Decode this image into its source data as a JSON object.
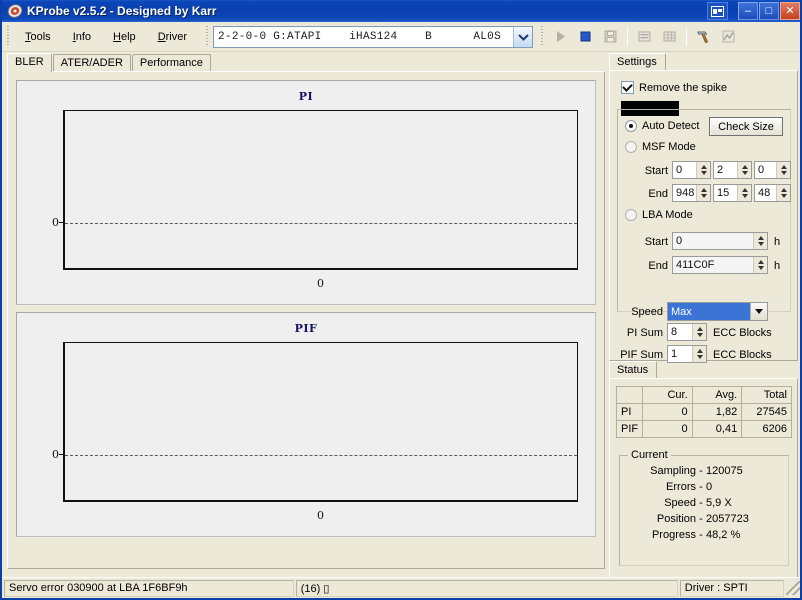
{
  "window": {
    "title": "KProbe v2.5.2 - Designed by Karr",
    "app_icon": "disc-icon",
    "restore_label": "❑",
    "minimize_label": "–",
    "maximize_label": "□",
    "close_label": "✕"
  },
  "menu": {
    "items": [
      {
        "pre": "",
        "accel": "T",
        "post": "ools"
      },
      {
        "pre": "",
        "accel": "I",
        "post": "nfo"
      },
      {
        "pre": "",
        "accel": "H",
        "post": "elp"
      },
      {
        "pre": "",
        "accel": "D",
        "post": "river"
      }
    ]
  },
  "drive": {
    "value": "2-2-0-0 G:ATAPI    iHAS124    B      AL0S",
    "dropdown_icon": "chevron-down-icon"
  },
  "toolbar": {
    "buttons": [
      {
        "name": "start-scan-button",
        "icon": "play-icon",
        "enabled": false
      },
      {
        "name": "stop-scan-button",
        "icon": "stop-square-icon",
        "enabled": true
      },
      {
        "name": "save-button",
        "icon": "save-disk-icon",
        "enabled": false
      },
      {
        "name": "list-view-button",
        "icon": "list-icon",
        "enabled": false
      },
      {
        "name": "grid-view-button",
        "icon": "grid-icon",
        "enabled": false
      },
      {
        "name": "tools-button",
        "icon": "hammer-icon",
        "enabled": true
      },
      {
        "name": "graph-button",
        "icon": "chart-icon",
        "enabled": false
      }
    ]
  },
  "tabs": [
    {
      "label": "BLER",
      "selected": true
    },
    {
      "label": "ATER/ADER",
      "selected": false
    },
    {
      "label": "Performance",
      "selected": false
    }
  ],
  "chart_data": [
    {
      "type": "line",
      "title": "PI",
      "xlabel": "",
      "ylabel": "",
      "x": [],
      "values": [],
      "yticks": [
        "0"
      ],
      "xticks": [
        "0"
      ],
      "xlim": [
        0,
        0
      ],
      "ylim": [
        0,
        0
      ],
      "grid": true,
      "legend": "none",
      "note": "empty plot; single dashed gridline at y=0"
    },
    {
      "type": "line",
      "title": "PIF",
      "xlabel": "",
      "ylabel": "",
      "x": [],
      "values": [],
      "yticks": [
        "0"
      ],
      "xticks": [
        "0"
      ],
      "xlim": [
        0,
        0
      ],
      "ylim": [
        0,
        0
      ],
      "grid": true,
      "legend": "none",
      "note": "empty plot; single dashed gridline at y=0"
    }
  ],
  "settings": {
    "header": "Settings",
    "remove_spike": {
      "label": "Remove the spike",
      "checked": true
    },
    "auto_detect": {
      "label": "Auto Detect",
      "selected": true
    },
    "check_size": {
      "label": "Check Size"
    },
    "msf_mode": {
      "label": "MSF Mode",
      "selected": false
    },
    "msf_start_label": "Start",
    "msf_start": [
      "0",
      "2",
      "0"
    ],
    "msf_end_label": "End",
    "msf_end": [
      "948",
      "15",
      "48"
    ],
    "lba_mode": {
      "label": "LBA Mode",
      "selected": false
    },
    "lba_start_label": "Start",
    "lba_start": "0",
    "lba_start_unit": "h",
    "lba_end_label": "End",
    "lba_end": "411C0F",
    "lba_end_unit": "h",
    "speed_label": "Speed",
    "speed_value": "Max",
    "pi_sum_label": "PI Sum",
    "pi_sum_value": "8",
    "pi_sum_unit": "ECC Blocks",
    "pif_sum_label": "PIF Sum",
    "pif_sum_value": "1",
    "pif_sum_unit": "ECC Blocks"
  },
  "status": {
    "header": "Status",
    "table": {
      "columns": [
        "",
        "Cur.",
        "Avg.",
        "Total"
      ],
      "rows": [
        {
          "name": "PI",
          "cur": "0",
          "avg": "1,82",
          "total": "27545"
        },
        {
          "name": "PIF",
          "cur": "0",
          "avg": "0,41",
          "total": "6206"
        }
      ]
    },
    "current": {
      "title": "Current",
      "rows": [
        {
          "key": "Sampling",
          "dash": "-",
          "value": "120075"
        },
        {
          "key": "Errors",
          "dash": "-",
          "value": "0"
        },
        {
          "key": "Speed",
          "dash": "-",
          "value": "5,9  X"
        },
        {
          "key": "Position",
          "dash": "-",
          "value": "2057723"
        },
        {
          "key": "Progress",
          "dash": "-",
          "value": "48,2  %"
        }
      ]
    }
  },
  "statusbar": {
    "message": "Servo error 030900 at LBA 1F6BF9h",
    "count": "(16)  ▯",
    "driver": "Driver : SPTI"
  },
  "colors": {
    "titlebar": "#0a3fae",
    "face": "#ece9d8",
    "chart_title": "#13135e",
    "selection": "#3b74d6",
    "toolbar_enabled": "#2558c8"
  }
}
